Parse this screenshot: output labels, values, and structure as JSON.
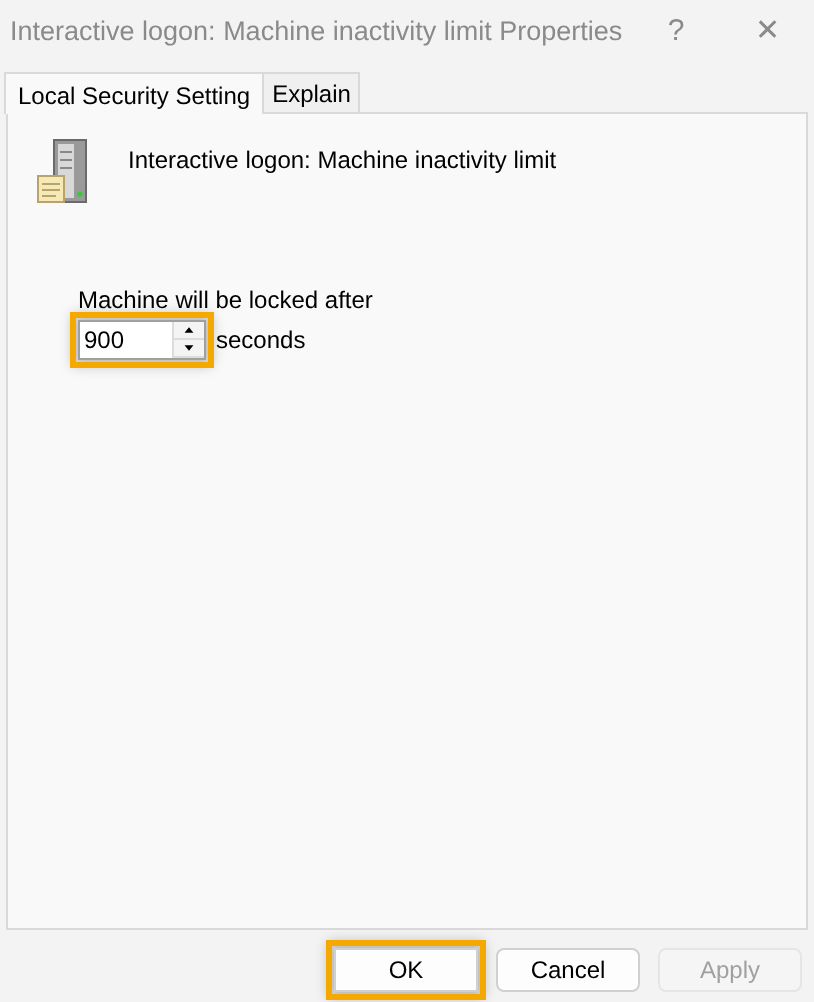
{
  "window": {
    "title": "Interactive logon: Machine inactivity limit Properties",
    "help": "?",
    "close": "✕"
  },
  "tabs": [
    {
      "label": "Local Security Setting",
      "selected": true
    },
    {
      "label": "Explain",
      "selected": false
    }
  ],
  "policy": {
    "name": "Interactive logon: Machine inactivity limit"
  },
  "setting": {
    "label": "Machine will be locked after",
    "value": "900",
    "unit": "seconds",
    "highlighted": true
  },
  "buttons": [
    {
      "label": "OK",
      "disabled": false,
      "highlighted": true
    },
    {
      "label": "Cancel",
      "disabled": false,
      "highlighted": false
    },
    {
      "label": "Apply",
      "disabled": true,
      "highlighted": false
    }
  ]
}
